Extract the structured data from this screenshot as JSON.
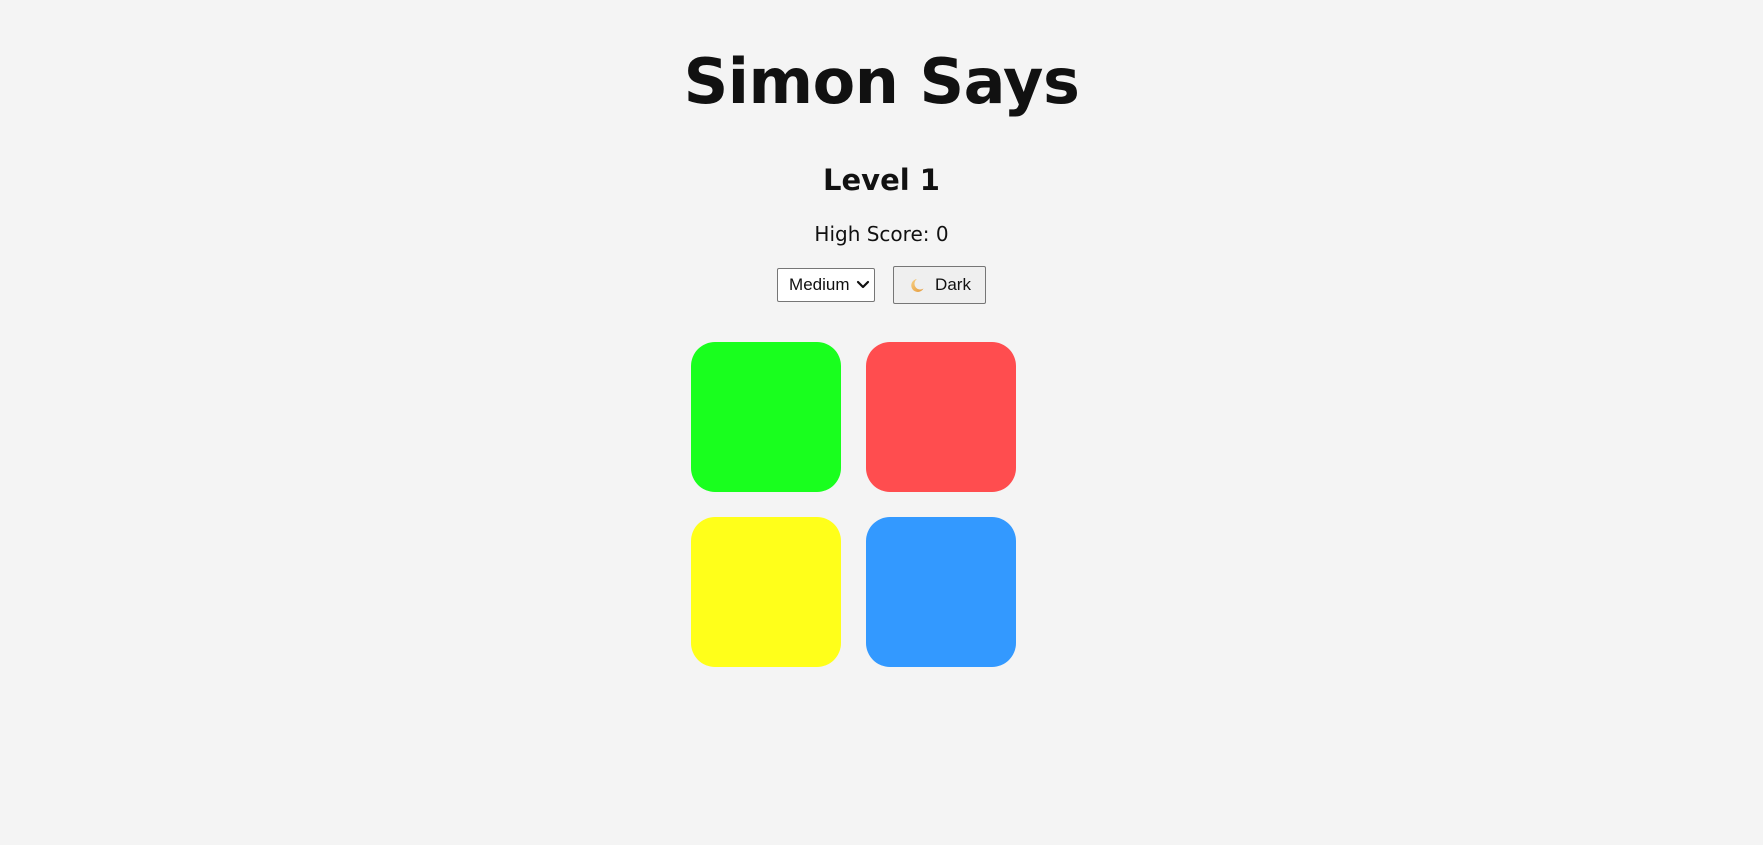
{
  "game": {
    "title": "Simon Says",
    "level_text": "Level 1",
    "high_score_text": "High Score: 0"
  },
  "controls": {
    "difficulty": {
      "selected": "Medium",
      "icon": "chevron-down-icon"
    },
    "theme_button": {
      "icon": "moon-icon",
      "label": "Dark"
    }
  },
  "pads": [
    {
      "name": "green",
      "color": "#19ff1e"
    },
    {
      "name": "red",
      "color": "#ff4d4f"
    },
    {
      "name": "yellow",
      "color": "#ffff1a"
    },
    {
      "name": "blue",
      "color": "#3399ff"
    }
  ],
  "colors": {
    "background": "#f4f4f4",
    "text": "#111111"
  }
}
